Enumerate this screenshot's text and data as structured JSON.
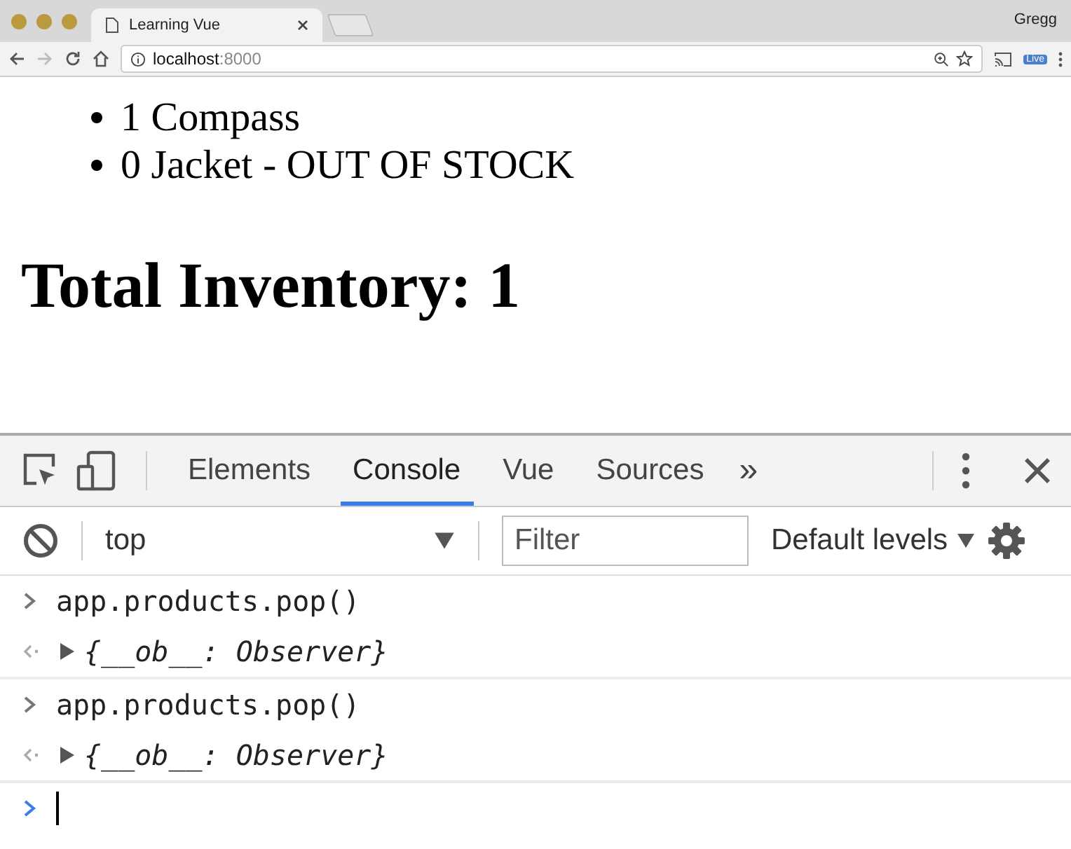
{
  "browser": {
    "tab": {
      "title": "Learning Vue"
    },
    "profile": "Gregg",
    "address": {
      "host": "localhost",
      "port": ":8000"
    },
    "extension_badge": "Live"
  },
  "page": {
    "items": [
      "1 Compass",
      "0 Jacket - OUT OF STOCK"
    ],
    "heading": "Total Inventory: 1"
  },
  "devtools": {
    "tabs": [
      {
        "label": "Elements",
        "selected": false
      },
      {
        "label": "Console",
        "selected": true
      },
      {
        "label": "Vue",
        "selected": false
      },
      {
        "label": "Sources",
        "selected": false
      }
    ],
    "more": "»",
    "context": "top",
    "filter": {
      "placeholder": "Filter"
    },
    "levels": "Default levels",
    "console": [
      {
        "kind": "input",
        "text": "app.products.pop()"
      },
      {
        "kind": "output",
        "text": "{__ob__: Observer}"
      },
      {
        "kind": "input",
        "text": "app.products.pop()"
      },
      {
        "kind": "output",
        "text": "{__ob__: Observer}"
      },
      {
        "kind": "prompt"
      }
    ]
  }
}
